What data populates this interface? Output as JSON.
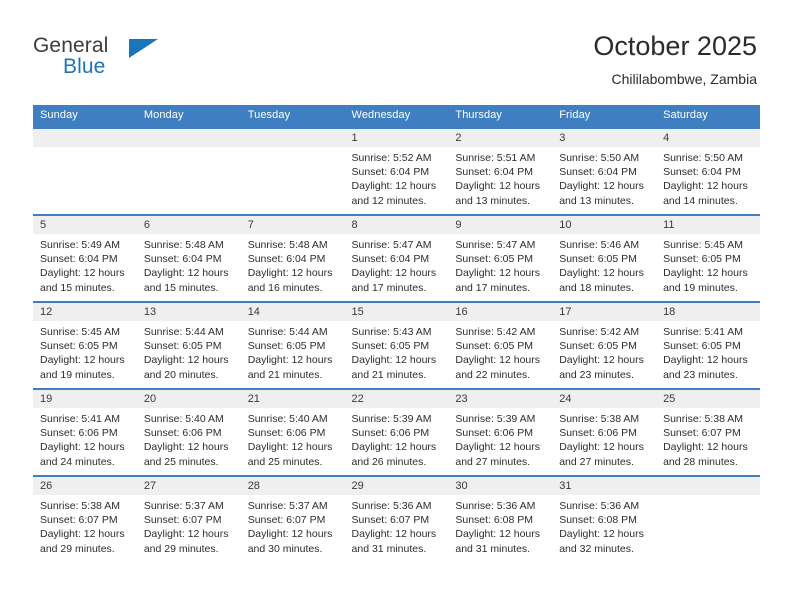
{
  "logo": {
    "word_one": "General",
    "word_two": "Blue",
    "triangle_icon": "triangle-logo-icon",
    "brand_blue": "#1b75bb",
    "brand_dark": "#3c3c3c"
  },
  "header": {
    "title": "October 2025",
    "subtitle": "Chililabombwe, Zambia"
  },
  "theme": {
    "header_row_bg": "#3f7fc1",
    "daynum_band_bg": "#efefef",
    "row_border": "#3f7fc1",
    "text": "#2d2d2d"
  },
  "weekdays": [
    "Sunday",
    "Monday",
    "Tuesday",
    "Wednesday",
    "Thursday",
    "Friday",
    "Saturday"
  ],
  "labels": {
    "sunrise_prefix": "Sunrise:",
    "sunset_prefix": "Sunset:",
    "daylight_prefix": "Daylight:"
  },
  "weeks": [
    [
      {
        "day": "",
        "sunrise": "",
        "sunset": "",
        "daylight_line1": "",
        "daylight_line2": "",
        "blank": true
      },
      {
        "day": "",
        "sunrise": "",
        "sunset": "",
        "daylight_line1": "",
        "daylight_line2": "",
        "blank": true
      },
      {
        "day": "",
        "sunrise": "",
        "sunset": "",
        "daylight_line1": "",
        "daylight_line2": "",
        "blank": true
      },
      {
        "day": "1",
        "sunrise": "Sunrise: 5:52 AM",
        "sunset": "Sunset: 6:04 PM",
        "daylight_line1": "Daylight: 12 hours",
        "daylight_line2": "and 12 minutes.",
        "blank": false
      },
      {
        "day": "2",
        "sunrise": "Sunrise: 5:51 AM",
        "sunset": "Sunset: 6:04 PM",
        "daylight_line1": "Daylight: 12 hours",
        "daylight_line2": "and 13 minutes.",
        "blank": false
      },
      {
        "day": "3",
        "sunrise": "Sunrise: 5:50 AM",
        "sunset": "Sunset: 6:04 PM",
        "daylight_line1": "Daylight: 12 hours",
        "daylight_line2": "and 13 minutes.",
        "blank": false
      },
      {
        "day": "4",
        "sunrise": "Sunrise: 5:50 AM",
        "sunset": "Sunset: 6:04 PM",
        "daylight_line1": "Daylight: 12 hours",
        "daylight_line2": "and 14 minutes.",
        "blank": false
      }
    ],
    [
      {
        "day": "5",
        "sunrise": "Sunrise: 5:49 AM",
        "sunset": "Sunset: 6:04 PM",
        "daylight_line1": "Daylight: 12 hours",
        "daylight_line2": "and 15 minutes.",
        "blank": false
      },
      {
        "day": "6",
        "sunrise": "Sunrise: 5:48 AM",
        "sunset": "Sunset: 6:04 PM",
        "daylight_line1": "Daylight: 12 hours",
        "daylight_line2": "and 15 minutes.",
        "blank": false
      },
      {
        "day": "7",
        "sunrise": "Sunrise: 5:48 AM",
        "sunset": "Sunset: 6:04 PM",
        "daylight_line1": "Daylight: 12 hours",
        "daylight_line2": "and 16 minutes.",
        "blank": false
      },
      {
        "day": "8",
        "sunrise": "Sunrise: 5:47 AM",
        "sunset": "Sunset: 6:04 PM",
        "daylight_line1": "Daylight: 12 hours",
        "daylight_line2": "and 17 minutes.",
        "blank": false
      },
      {
        "day": "9",
        "sunrise": "Sunrise: 5:47 AM",
        "sunset": "Sunset: 6:05 PM",
        "daylight_line1": "Daylight: 12 hours",
        "daylight_line2": "and 17 minutes.",
        "blank": false
      },
      {
        "day": "10",
        "sunrise": "Sunrise: 5:46 AM",
        "sunset": "Sunset: 6:05 PM",
        "daylight_line1": "Daylight: 12 hours",
        "daylight_line2": "and 18 minutes.",
        "blank": false
      },
      {
        "day": "11",
        "sunrise": "Sunrise: 5:45 AM",
        "sunset": "Sunset: 6:05 PM",
        "daylight_line1": "Daylight: 12 hours",
        "daylight_line2": "and 19 minutes.",
        "blank": false
      }
    ],
    [
      {
        "day": "12",
        "sunrise": "Sunrise: 5:45 AM",
        "sunset": "Sunset: 6:05 PM",
        "daylight_line1": "Daylight: 12 hours",
        "daylight_line2": "and 19 minutes.",
        "blank": false
      },
      {
        "day": "13",
        "sunrise": "Sunrise: 5:44 AM",
        "sunset": "Sunset: 6:05 PM",
        "daylight_line1": "Daylight: 12 hours",
        "daylight_line2": "and 20 minutes.",
        "blank": false
      },
      {
        "day": "14",
        "sunrise": "Sunrise: 5:44 AM",
        "sunset": "Sunset: 6:05 PM",
        "daylight_line1": "Daylight: 12 hours",
        "daylight_line2": "and 21 minutes.",
        "blank": false
      },
      {
        "day": "15",
        "sunrise": "Sunrise: 5:43 AM",
        "sunset": "Sunset: 6:05 PM",
        "daylight_line1": "Daylight: 12 hours",
        "daylight_line2": "and 21 minutes.",
        "blank": false
      },
      {
        "day": "16",
        "sunrise": "Sunrise: 5:42 AM",
        "sunset": "Sunset: 6:05 PM",
        "daylight_line1": "Daylight: 12 hours",
        "daylight_line2": "and 22 minutes.",
        "blank": false
      },
      {
        "day": "17",
        "sunrise": "Sunrise: 5:42 AM",
        "sunset": "Sunset: 6:05 PM",
        "daylight_line1": "Daylight: 12 hours",
        "daylight_line2": "and 23 minutes.",
        "blank": false
      },
      {
        "day": "18",
        "sunrise": "Sunrise: 5:41 AM",
        "sunset": "Sunset: 6:05 PM",
        "daylight_line1": "Daylight: 12 hours",
        "daylight_line2": "and 23 minutes.",
        "blank": false
      }
    ],
    [
      {
        "day": "19",
        "sunrise": "Sunrise: 5:41 AM",
        "sunset": "Sunset: 6:06 PM",
        "daylight_line1": "Daylight: 12 hours",
        "daylight_line2": "and 24 minutes.",
        "blank": false
      },
      {
        "day": "20",
        "sunrise": "Sunrise: 5:40 AM",
        "sunset": "Sunset: 6:06 PM",
        "daylight_line1": "Daylight: 12 hours",
        "daylight_line2": "and 25 minutes.",
        "blank": false
      },
      {
        "day": "21",
        "sunrise": "Sunrise: 5:40 AM",
        "sunset": "Sunset: 6:06 PM",
        "daylight_line1": "Daylight: 12 hours",
        "daylight_line2": "and 25 minutes.",
        "blank": false
      },
      {
        "day": "22",
        "sunrise": "Sunrise: 5:39 AM",
        "sunset": "Sunset: 6:06 PM",
        "daylight_line1": "Daylight: 12 hours",
        "daylight_line2": "and 26 minutes.",
        "blank": false
      },
      {
        "day": "23",
        "sunrise": "Sunrise: 5:39 AM",
        "sunset": "Sunset: 6:06 PM",
        "daylight_line1": "Daylight: 12 hours",
        "daylight_line2": "and 27 minutes.",
        "blank": false
      },
      {
        "day": "24",
        "sunrise": "Sunrise: 5:38 AM",
        "sunset": "Sunset: 6:06 PM",
        "daylight_line1": "Daylight: 12 hours",
        "daylight_line2": "and 27 minutes.",
        "blank": false
      },
      {
        "day": "25",
        "sunrise": "Sunrise: 5:38 AM",
        "sunset": "Sunset: 6:07 PM",
        "daylight_line1": "Daylight: 12 hours",
        "daylight_line2": "and 28 minutes.",
        "blank": false
      }
    ],
    [
      {
        "day": "26",
        "sunrise": "Sunrise: 5:38 AM",
        "sunset": "Sunset: 6:07 PM",
        "daylight_line1": "Daylight: 12 hours",
        "daylight_line2": "and 29 minutes.",
        "blank": false
      },
      {
        "day": "27",
        "sunrise": "Sunrise: 5:37 AM",
        "sunset": "Sunset: 6:07 PM",
        "daylight_line1": "Daylight: 12 hours",
        "daylight_line2": "and 29 minutes.",
        "blank": false
      },
      {
        "day": "28",
        "sunrise": "Sunrise: 5:37 AM",
        "sunset": "Sunset: 6:07 PM",
        "daylight_line1": "Daylight: 12 hours",
        "daylight_line2": "and 30 minutes.",
        "blank": false
      },
      {
        "day": "29",
        "sunrise": "Sunrise: 5:36 AM",
        "sunset": "Sunset: 6:07 PM",
        "daylight_line1": "Daylight: 12 hours",
        "daylight_line2": "and 31 minutes.",
        "blank": false
      },
      {
        "day": "30",
        "sunrise": "Sunrise: 5:36 AM",
        "sunset": "Sunset: 6:08 PM",
        "daylight_line1": "Daylight: 12 hours",
        "daylight_line2": "and 31 minutes.",
        "blank": false
      },
      {
        "day": "31",
        "sunrise": "Sunrise: 5:36 AM",
        "sunset": "Sunset: 6:08 PM",
        "daylight_line1": "Daylight: 12 hours",
        "daylight_line2": "and 32 minutes.",
        "blank": false
      },
      {
        "day": "",
        "sunrise": "",
        "sunset": "",
        "daylight_line1": "",
        "daylight_line2": "",
        "blank": true
      }
    ]
  ]
}
